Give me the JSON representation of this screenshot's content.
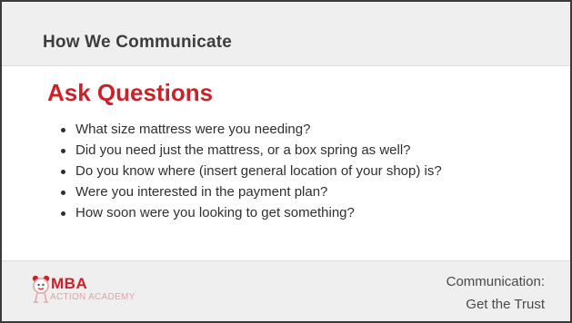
{
  "header": {
    "title": "How We Communicate"
  },
  "main": {
    "heading": "Ask Questions",
    "bullets": [
      "What size mattress were you needing?",
      "Did you need just the mattress, or a box spring as well?",
      "Do you know where (insert general location of your shop) is?",
      "Were you interested in the payment plan?",
      "How soon were you looking to get something?"
    ]
  },
  "footer": {
    "logo": {
      "brand": "MBA",
      "subtitle": "ACTION ACADEMY",
      "icon": "alarm-clock-mascot-icon"
    },
    "caption_line1": "Communication:",
    "caption_line2": "Get the Trust"
  },
  "colors": {
    "accent": "#cc2128",
    "band": "#efefef",
    "text": "#2f2f2f"
  }
}
